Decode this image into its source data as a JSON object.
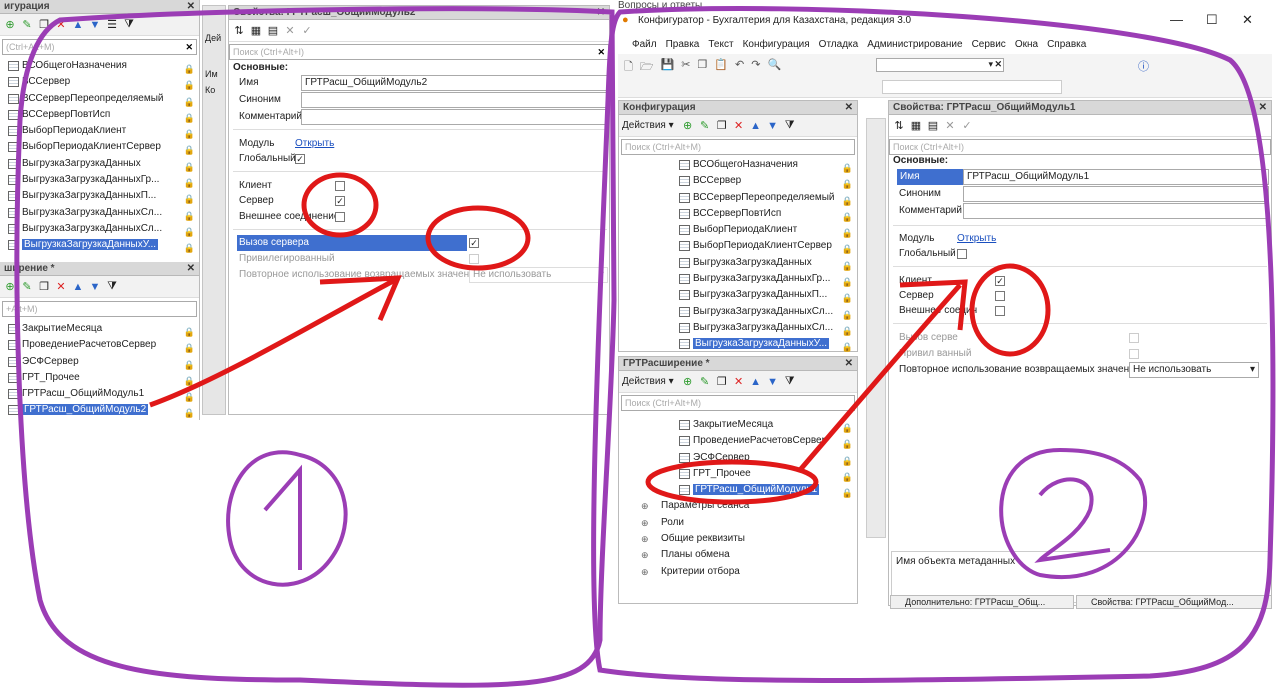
{
  "left": {
    "config_panel": {
      "title": "игурация",
      "search_placeholder": "(Ctrl+Alt+M)",
      "items": [
        "ВСОбщегоНазначения",
        "ВССервер",
        "ВССерверПереопределяемый",
        "ВССерверПовтИсп",
        "ВыборПериодаКлиент",
        "ВыборПериодаКлиентСервер",
        "ВыгрузкаЗагрузкаДанных",
        "ВыгрузкаЗагрузкаДанныхГр...",
        "ВыгрузкаЗагрузкаДанныхП...",
        "ВыгрузкаЗагрузкаДанныхСл...",
        "ВыгрузкаЗагрузкаДанныхСл...",
        "ВыгрузкаЗагрузкаДанныхУ..."
      ]
    },
    "ext_panel": {
      "title": "ширение *",
      "search_placeholder": "+Alt+M)",
      "items": [
        "ЗакрытиеМесяца",
        "ПроведениеРасчетовСервер",
        "ЭСФСервер",
        "ГРТ_Прочее",
        "ГРТРасш_ОбщийМодуль1",
        "ГРТРасш_ОбщийМодуль2"
      ]
    },
    "props": {
      "title": "Свойства: ГРТРасш_ОбщийМодуль2",
      "search_placeholder": "Поиск (Ctrl+Alt+I)",
      "section": "Основные:",
      "name_label": "Имя",
      "name_value": "ГРТРасш_ОбщийМодуль2",
      "synonym_label": "Синоним",
      "comment_label": "Комментарий",
      "module_label": "Модуль",
      "module_link": "Открыть",
      "global_label": "Глобальный",
      "client_label": "Клиент",
      "server_label": "Сервер",
      "external_label": "Внешнее соединение",
      "server_call_label": "Вызов сервера",
      "privileged_label": "Привилегированный",
      "reuse_label": "Повторное использование возвращаемых значени",
      "reuse_value": "Не использовать"
    },
    "tabs_stub": [
      "Дей",
      "Им",
      "Ко"
    ]
  },
  "right": {
    "top_label": "Вопросы и ответы",
    "window_title": "Конфигуратор - Бухгалтерия для Казахстана, редакция 3.0",
    "menu": [
      "Файл",
      "Правка",
      "Текст",
      "Конфигурация",
      "Отладка",
      "Администрирование",
      "Сервис",
      "Окна",
      "Справка"
    ],
    "config_panel": {
      "title": "Конфигурация",
      "actions_label": "Действия ▾",
      "search_placeholder": "Поиск (Ctrl+Alt+M)",
      "items": [
        "ВСОбщегоНазначения",
        "ВССервер",
        "ВССерверПереопределяемый",
        "ВССерверПовтИсп",
        "ВыборПериодаКлиент",
        "ВыборПериодаКлиентСервер",
        "ВыгрузкаЗагрузкаДанных",
        "ВыгрузкаЗагрузкаДанныхГр...",
        "ВыгрузкаЗагрузкаДанныхП...",
        "ВыгрузкаЗагрузкаДанныхСл...",
        "ВыгрузкаЗагрузкаДанныхСл...",
        "ВыгрузкаЗагрузкаДанныхУ..."
      ]
    },
    "ext_panel": {
      "title": "ГРТРасширение *",
      "actions_label": "Действия ▾",
      "search_placeholder": "Поиск (Ctrl+Alt+M)",
      "items": [
        "ЗакрытиеМесяца",
        "ПроведениеРасчетовСервер",
        "ЭСФСервер",
        "ГРТ_Прочее",
        "ГРТРасш_ОбщийМодуль1"
      ],
      "groups": [
        "Параметры сеанса",
        "Роли",
        "Общие реквизиты",
        "Планы обмена",
        "Критерии отбора"
      ]
    },
    "props": {
      "title": "Свойства: ГРТРасш_ОбщийМодуль1",
      "search_placeholder": "Поиск (Ctrl+Alt+I)",
      "section": "Основные:",
      "name_label": "Имя",
      "name_value": "ГРТРасш_ОбщийМодуль1",
      "synonym_label": "Синоним",
      "comment_label": "Комментарий",
      "module_label": "Модуль",
      "module_link": "Открыть",
      "global_label": "Глобальный",
      "client_label": "Клиент",
      "server_label": "Сервер",
      "external_label": "Внешнее соедин",
      "server_call_label": "Вызов серве",
      "privileged_label": "Привил      ванный",
      "reuse_label": "Повторное использование возвращаемых значений",
      "reuse_value": "Не использовать",
      "status_text": "Имя объекта метаданных"
    },
    "bottom_tabs": [
      "Дополнительно: ГРТРасш_Общ...",
      "Свойства: ГРТРасш_ОбщийМод..."
    ]
  },
  "annotations": {
    "label_1": "1",
    "label_2": "2"
  }
}
